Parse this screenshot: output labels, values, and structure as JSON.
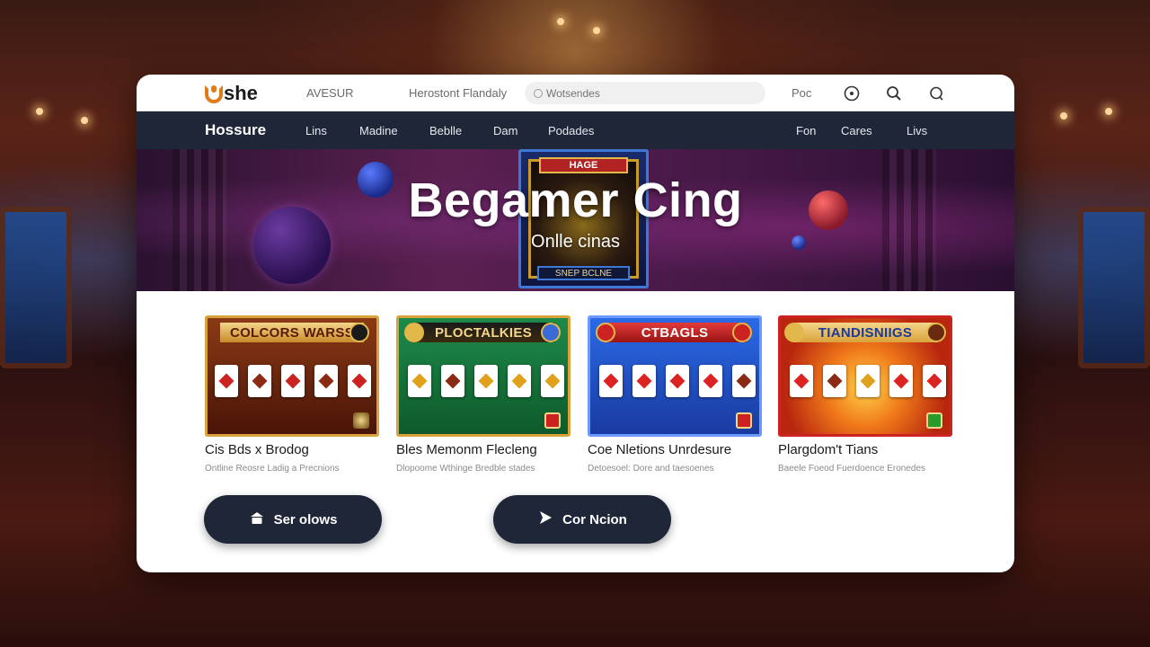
{
  "topbar": {
    "logo": "she",
    "link1": "AVESUR",
    "link2": "Herostont Flandaly",
    "search_placeholder": "Wotsendes",
    "link3": "Poc"
  },
  "navbar": {
    "brand": "Hossure",
    "left_items": [
      "Lins",
      "Madine",
      "Beblle",
      "Dam",
      "Podades"
    ],
    "right_items": [
      "Fon",
      "Cares",
      "Livs"
    ]
  },
  "hero": {
    "title": "Begamer Cing",
    "subtitle": "Onlle cinas",
    "card_top": "HAGE",
    "card_bottom": "SNEP BCLNE"
  },
  "games": [
    {
      "thumb_title": "COLCORS WARSS",
      "title": "Cis Bds x Brodog",
      "desc": "Ontline Reosre Ladig a Precnions"
    },
    {
      "thumb_title": "PLOCTALKIES",
      "title": "Bles Memonm Flecleng",
      "desc": "Dlopoome Wthinge Bredble stades"
    },
    {
      "thumb_title": "CTBAGLS",
      "title": "Coe Nletions Unrdesure",
      "desc": "Detoesoel: Dore and taesoenes"
    },
    {
      "thumb_title": "TIANDISNIIGS",
      "title": "Plargdom't Tians",
      "desc": "Baeele Foeod Fuerdoence Eronedes"
    }
  ],
  "buttons": {
    "primary": "Ser olows",
    "secondary": "Cor Ncion"
  },
  "colors": {
    "nav_bg": "#1f2637",
    "accent_orange": "#e07b1a",
    "card_gold": "#c79a2a"
  }
}
